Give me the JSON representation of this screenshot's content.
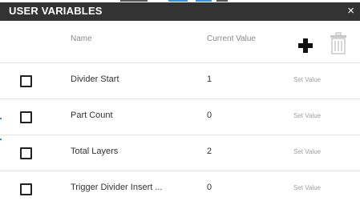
{
  "dialog": {
    "title": "USER VARIABLES",
    "close_glyph": "×"
  },
  "columns": {
    "name": "Name",
    "current_value": "Current Value"
  },
  "toolbar": {
    "add_icon": "plus-icon",
    "delete_icon": "trash-icon"
  },
  "variables": [
    {
      "name": "Divider Start",
      "value": "1",
      "action": "Set Value",
      "checked": false
    },
    {
      "name": "Part Count",
      "value": "0",
      "action": "Set Value",
      "checked": false
    },
    {
      "name": "Total Layers",
      "value": "2",
      "action": "Set Value",
      "checked": false
    },
    {
      "name": "Trigger Divider Insert ...",
      "value": "0",
      "action": "Set Value",
      "checked": false
    }
  ],
  "colors": {
    "titlebar": "#333333",
    "accent": "#3a8fd8"
  }
}
